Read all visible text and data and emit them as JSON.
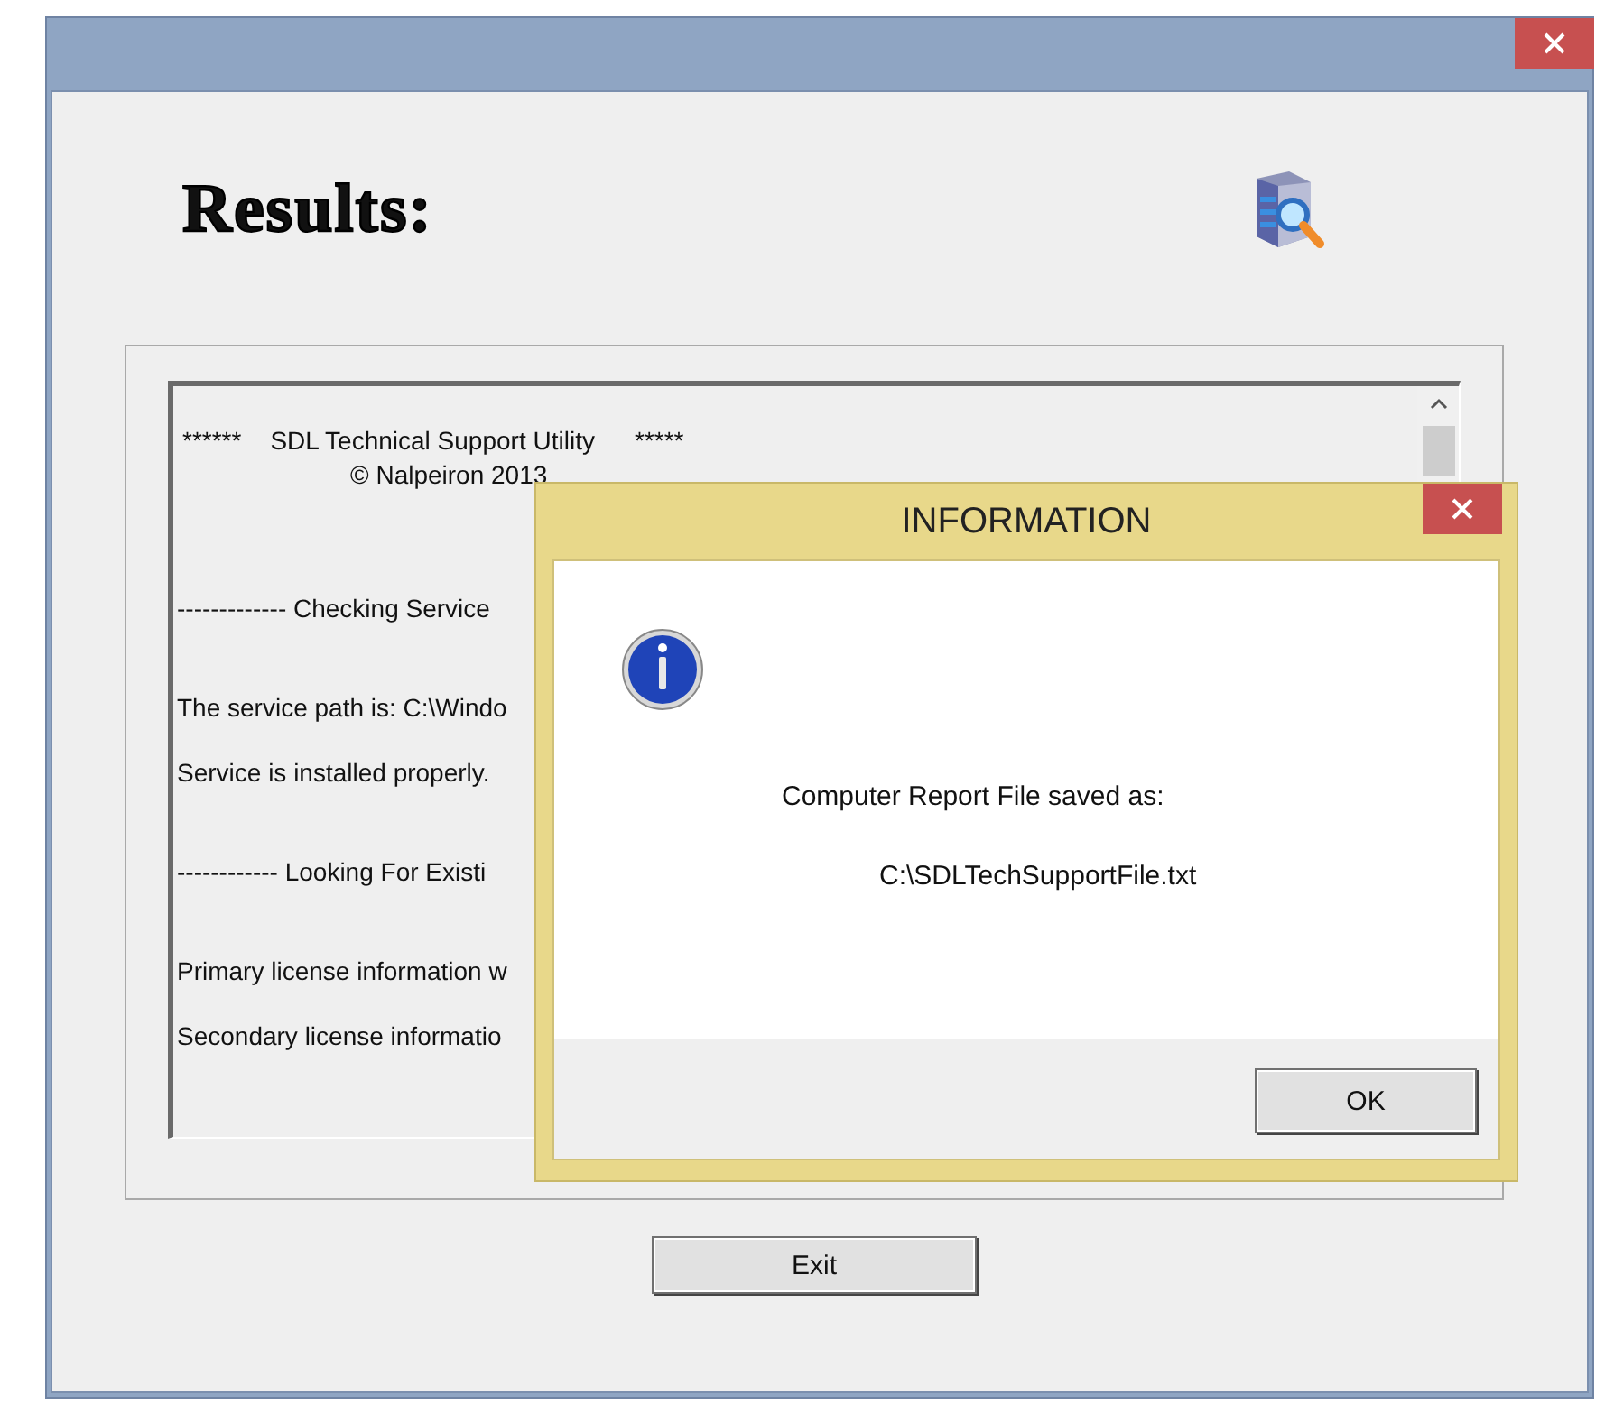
{
  "heading": "Results:",
  "log": [
    {
      "kind": "banner",
      "texts": [
        "******",
        "SDL Technical Support Utility",
        "*****"
      ]
    },
    {
      "kind": "credit",
      "texts": [
        "© Nalpeiron  2013"
      ]
    },
    {
      "kind": "section",
      "texts": [
        "------------- Checking Service"
      ]
    },
    {
      "kind": "line",
      "texts": [
        "The service path is: C:\\Windo"
      ]
    },
    {
      "kind": "line",
      "texts": [
        "Service is installed properly."
      ]
    },
    {
      "kind": "section",
      "texts": [
        "------------  Looking For Existi"
      ]
    },
    {
      "kind": "line",
      "texts": [
        "Primary license information w"
      ]
    },
    {
      "kind": "line",
      "texts": [
        "Secondary license informatio"
      ]
    }
  ],
  "exit_button": "Exit",
  "dialog": {
    "title": "INFORMATION",
    "message": "Computer Report File saved as:",
    "path": "C:\\SDLTechSupportFile.txt",
    "ok_button": "OK"
  }
}
